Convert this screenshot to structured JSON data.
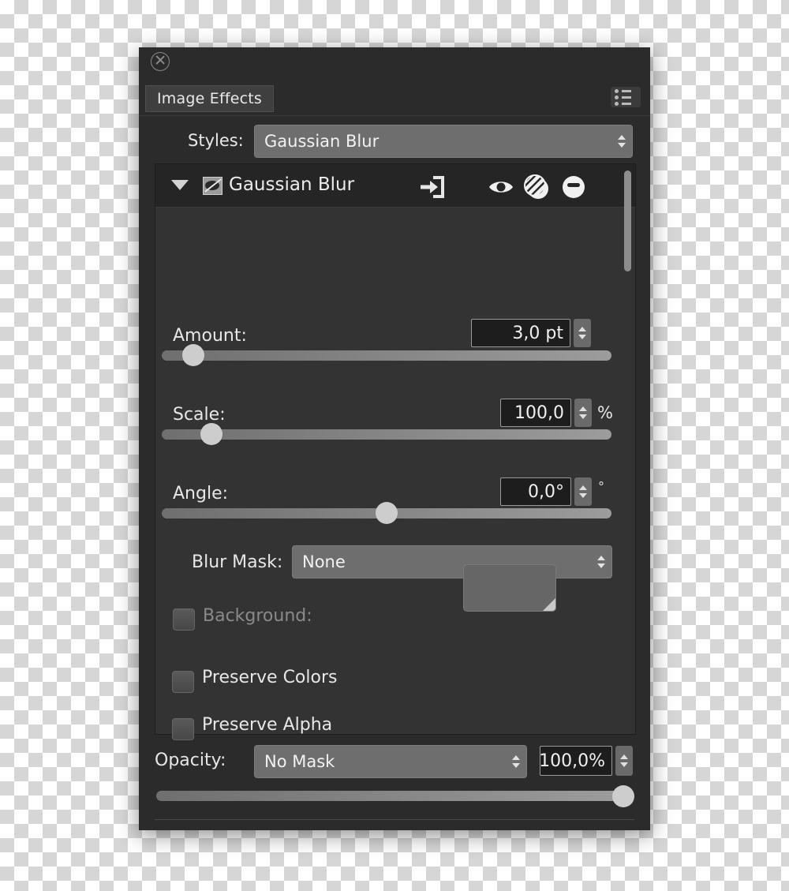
{
  "window": {
    "close_icon": "close-circle-icon",
    "tab_label": "Image Effects",
    "list_icon": "list-view-icon"
  },
  "styles": {
    "label": "Styles:",
    "selected": "Gaussian Blur",
    "stepper_icon": "stepper-arrows-icon"
  },
  "effect": {
    "disclosure_icon": "triangle-down-icon",
    "type_icon": "blur-effect-icon",
    "name": "Gaussian Blur",
    "insert_icon": "insert-into-icon",
    "visibility_icon": "eye-icon",
    "blend_icon": "hatched-circle-icon",
    "mask_icon": "mask-circle-icon"
  },
  "controls": {
    "amount": {
      "label": "Amount:",
      "value": "3,0 pt",
      "unit": "",
      "slider_percent": 7
    },
    "scale": {
      "label": "Scale:",
      "value": "100,0",
      "unit": "%",
      "slider_percent": 11
    },
    "angle": {
      "label": "Angle:",
      "value": "0,0°",
      "unit": "°",
      "slider_percent": 50
    },
    "blur_mask": {
      "label": "Blur Mask:",
      "value": "None"
    },
    "background": {
      "label": "Background:",
      "checked": false,
      "swatch_color": "#666666"
    },
    "preserve_colors": {
      "label": "Preserve Colors",
      "checked": false
    },
    "preserve_alpha": {
      "label": "Preserve Alpha",
      "checked": false
    }
  },
  "opacity": {
    "label": "Opacity:",
    "mask_value": "No Mask",
    "value": "100,0%",
    "slider_percent": 100
  },
  "toolbar": {
    "items": [
      {
        "name": "add-effect-button",
        "icon": "plus-in-square-icon"
      },
      {
        "name": "edit-effect-button",
        "icon": "pencil-edit-icon"
      },
      {
        "name": "path-nodes-button",
        "icon": "path-nodes-icon"
      },
      {
        "name": "preview-button",
        "icon": "eye-icon"
      },
      {
        "name": "duplicate-add-button",
        "icon": "duplicate-plus-icon"
      },
      {
        "name": "layers-button",
        "icon": "layers-offset-icon"
      },
      {
        "name": "toggle-power-button",
        "icon": "power-icon"
      },
      {
        "name": "delete-button",
        "icon": "trash-icon"
      },
      {
        "name": "close-button",
        "icon": "circle-x-icon"
      }
    ]
  },
  "colors": {
    "panel_bg": "#2b2b2b",
    "list_bg": "#333333",
    "header_bg": "#252525",
    "popup_bg": "#6e6e6e",
    "field_bg": "#1d1d1d",
    "text": "#e7e7e7"
  }
}
